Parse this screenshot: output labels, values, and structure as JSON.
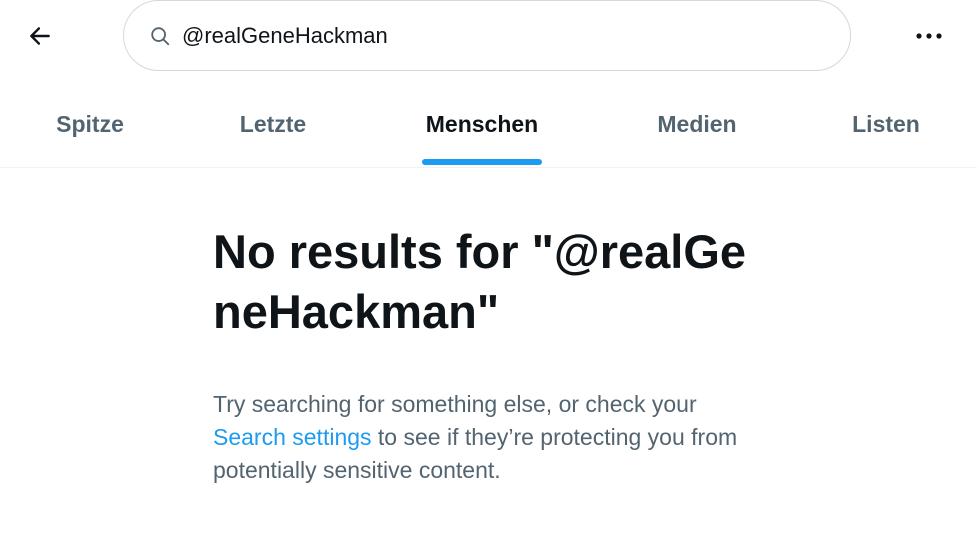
{
  "header": {
    "back_icon": "arrow-left-icon",
    "search": {
      "icon": "search-icon",
      "value": "@realGeneHackman",
      "placeholder": ""
    },
    "more_icon": "more-horizontal-icon"
  },
  "tabs": [
    {
      "label": "Spitze",
      "active": false
    },
    {
      "label": "Letzte",
      "active": false
    },
    {
      "label": "Menschen",
      "active": true
    },
    {
      "label": "Medien",
      "active": false
    },
    {
      "label": "Listen",
      "active": false
    }
  ],
  "empty_state": {
    "title": "No results for \"@realGeneHackman\"",
    "desc_before": "Try searching for something else, or check your ",
    "link_text": "Search settings",
    "desc_after": " to see if they’re protecting you from potentially sensitive content."
  },
  "colors": {
    "accent": "#1d9bf0",
    "text_primary": "#0f1419",
    "text_secondary": "#536471",
    "border": "#cfd9de"
  }
}
